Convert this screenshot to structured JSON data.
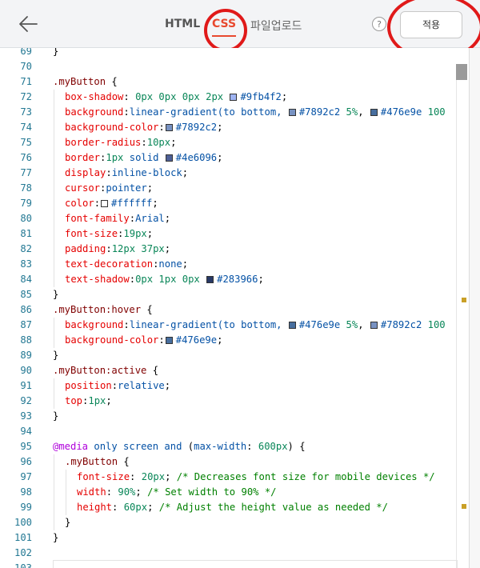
{
  "header": {
    "tabs": [
      {
        "label": "HTML",
        "active": false
      },
      {
        "label": "CSS",
        "active": true
      },
      {
        "label": "파일업로드",
        "active": false
      }
    ],
    "help_label": "?",
    "apply_label": "적용"
  },
  "colors": {
    "accent": "#e8492f",
    "annotation_circle": "#e01919"
  },
  "editor": {
    "lines": [
      {
        "n": "69",
        "indent": 0,
        "tokens": [
          {
            "c": "t-punc",
            "t": "}"
          }
        ]
      },
      {
        "n": "70",
        "indent": 0,
        "tokens": []
      },
      {
        "n": "71",
        "indent": 0,
        "tokens": [
          {
            "c": "t-sel",
            "t": ".myButton"
          },
          {
            "c": "t-punc",
            "t": " {"
          }
        ]
      },
      {
        "n": "72",
        "indent": 1,
        "tokens": [
          {
            "c": "t-prop",
            "t": "box-shadow"
          },
          {
            "c": "t-punc",
            "t": ": "
          },
          {
            "c": "t-num",
            "t": "0px 0px 0px 2px "
          },
          {
            "sw": "#9fb4f2"
          },
          {
            "c": "t-val",
            "t": "#9fb4f2"
          },
          {
            "c": "t-punc",
            "t": ";"
          }
        ]
      },
      {
        "n": "73",
        "indent": 1,
        "tokens": [
          {
            "c": "t-prop",
            "t": "background"
          },
          {
            "c": "t-punc",
            "t": ":"
          },
          {
            "c": "t-val",
            "t": "linear-gradient(to bottom, "
          },
          {
            "sw": "#7892c2"
          },
          {
            "c": "t-val",
            "t": "#7892c2 "
          },
          {
            "c": "t-num",
            "t": "5%"
          },
          {
            "c": "t-punc",
            "t": ", "
          },
          {
            "sw": "#476e9e"
          },
          {
            "c": "t-val",
            "t": "#476e9e "
          },
          {
            "c": "t-num",
            "t": "100"
          }
        ]
      },
      {
        "n": "74",
        "indent": 1,
        "tokens": [
          {
            "c": "t-prop",
            "t": "background-color"
          },
          {
            "c": "t-punc",
            "t": ":"
          },
          {
            "sw": "#7892c2"
          },
          {
            "c": "t-val",
            "t": "#7892c2"
          },
          {
            "c": "t-punc",
            "t": ";"
          }
        ]
      },
      {
        "n": "75",
        "indent": 1,
        "tokens": [
          {
            "c": "t-prop",
            "t": "border-radius"
          },
          {
            "c": "t-punc",
            "t": ":"
          },
          {
            "c": "t-num",
            "t": "10px"
          },
          {
            "c": "t-punc",
            "t": ";"
          }
        ]
      },
      {
        "n": "76",
        "indent": 1,
        "tokens": [
          {
            "c": "t-prop",
            "t": "border"
          },
          {
            "c": "t-punc",
            "t": ":"
          },
          {
            "c": "t-num",
            "t": "1px "
          },
          {
            "c": "t-val",
            "t": "solid "
          },
          {
            "sw": "#4e6096"
          },
          {
            "c": "t-val",
            "t": "#4e6096"
          },
          {
            "c": "t-punc",
            "t": ";"
          }
        ]
      },
      {
        "n": "77",
        "indent": 1,
        "tokens": [
          {
            "c": "t-prop",
            "t": "display"
          },
          {
            "c": "t-punc",
            "t": ":"
          },
          {
            "c": "t-val",
            "t": "inline-block"
          },
          {
            "c": "t-punc",
            "t": ";"
          }
        ]
      },
      {
        "n": "78",
        "indent": 1,
        "tokens": [
          {
            "c": "t-prop",
            "t": "cursor"
          },
          {
            "c": "t-punc",
            "t": ":"
          },
          {
            "c": "t-val",
            "t": "pointer"
          },
          {
            "c": "t-punc",
            "t": ";"
          }
        ]
      },
      {
        "n": "79",
        "indent": 1,
        "tokens": [
          {
            "c": "t-prop",
            "t": "color"
          },
          {
            "c": "t-punc",
            "t": ":"
          },
          {
            "sw": "#ffffff"
          },
          {
            "c": "t-val",
            "t": "#ffffff"
          },
          {
            "c": "t-punc",
            "t": ";"
          }
        ]
      },
      {
        "n": "80",
        "indent": 1,
        "tokens": [
          {
            "c": "t-prop",
            "t": "font-family"
          },
          {
            "c": "t-punc",
            "t": ":"
          },
          {
            "c": "t-val",
            "t": "Arial"
          },
          {
            "c": "t-punc",
            "t": ";"
          }
        ]
      },
      {
        "n": "81",
        "indent": 1,
        "tokens": [
          {
            "c": "t-prop",
            "t": "font-size"
          },
          {
            "c": "t-punc",
            "t": ":"
          },
          {
            "c": "t-num",
            "t": "19px"
          },
          {
            "c": "t-punc",
            "t": ";"
          }
        ]
      },
      {
        "n": "82",
        "indent": 1,
        "tokens": [
          {
            "c": "t-prop",
            "t": "padding"
          },
          {
            "c": "t-punc",
            "t": ":"
          },
          {
            "c": "t-num",
            "t": "12px 37px"
          },
          {
            "c": "t-punc",
            "t": ";"
          }
        ]
      },
      {
        "n": "83",
        "indent": 1,
        "tokens": [
          {
            "c": "t-prop",
            "t": "text-decoration"
          },
          {
            "c": "t-punc",
            "t": ":"
          },
          {
            "c": "t-val",
            "t": "none"
          },
          {
            "c": "t-punc",
            "t": ";"
          }
        ]
      },
      {
        "n": "84",
        "indent": 1,
        "tokens": [
          {
            "c": "t-prop",
            "t": "text-shadow"
          },
          {
            "c": "t-punc",
            "t": ":"
          },
          {
            "c": "t-num",
            "t": "0px 1px 0px "
          },
          {
            "sw": "#283966"
          },
          {
            "c": "t-val",
            "t": "#283966"
          },
          {
            "c": "t-punc",
            "t": ";"
          }
        ]
      },
      {
        "n": "85",
        "indent": 0,
        "tokens": [
          {
            "c": "t-punc",
            "t": "}"
          }
        ]
      },
      {
        "n": "86",
        "indent": 0,
        "tokens": [
          {
            "c": "t-sel",
            "t": ".myButton:hover"
          },
          {
            "c": "t-punc",
            "t": " {"
          }
        ]
      },
      {
        "n": "87",
        "indent": 1,
        "tokens": [
          {
            "c": "t-prop",
            "t": "background"
          },
          {
            "c": "t-punc",
            "t": ":"
          },
          {
            "c": "t-val",
            "t": "linear-gradient(to bottom, "
          },
          {
            "sw": "#476e9e"
          },
          {
            "c": "t-val",
            "t": "#476e9e "
          },
          {
            "c": "t-num",
            "t": "5%"
          },
          {
            "c": "t-punc",
            "t": ", "
          },
          {
            "sw": "#7892c2"
          },
          {
            "c": "t-val",
            "t": "#7892c2 "
          },
          {
            "c": "t-num",
            "t": "100"
          }
        ]
      },
      {
        "n": "88",
        "indent": 1,
        "tokens": [
          {
            "c": "t-prop",
            "t": "background-color"
          },
          {
            "c": "t-punc",
            "t": ":"
          },
          {
            "sw": "#476e9e"
          },
          {
            "c": "t-val",
            "t": "#476e9e"
          },
          {
            "c": "t-punc",
            "t": ";"
          }
        ]
      },
      {
        "n": "89",
        "indent": 0,
        "tokens": [
          {
            "c": "t-punc",
            "t": "}"
          }
        ]
      },
      {
        "n": "90",
        "indent": 0,
        "tokens": [
          {
            "c": "t-sel",
            "t": ".myButton:active"
          },
          {
            "c": "t-punc",
            "t": " {"
          }
        ]
      },
      {
        "n": "91",
        "indent": 1,
        "tokens": [
          {
            "c": "t-prop",
            "t": "position"
          },
          {
            "c": "t-punc",
            "t": ":"
          },
          {
            "c": "t-val",
            "t": "relative"
          },
          {
            "c": "t-punc",
            "t": ";"
          }
        ]
      },
      {
        "n": "92",
        "indent": 1,
        "tokens": [
          {
            "c": "t-prop",
            "t": "top"
          },
          {
            "c": "t-punc",
            "t": ":"
          },
          {
            "c": "t-num",
            "t": "1px"
          },
          {
            "c": "t-punc",
            "t": ";"
          }
        ]
      },
      {
        "n": "93",
        "indent": 0,
        "tokens": [
          {
            "c": "t-punc",
            "t": "}"
          }
        ]
      },
      {
        "n": "94",
        "indent": 0,
        "tokens": []
      },
      {
        "n": "95",
        "indent": 0,
        "tokens": [
          {
            "c": "t-kw",
            "t": "@media"
          },
          {
            "c": "t-val",
            "t": " only screen and "
          },
          {
            "c": "t-punc",
            "t": "("
          },
          {
            "c": "t-val",
            "t": "max-width"
          },
          {
            "c": "t-punc",
            "t": ": "
          },
          {
            "c": "t-num",
            "t": "600px"
          },
          {
            "c": "t-punc",
            "t": ") {"
          }
        ]
      },
      {
        "n": "96",
        "indent": 1,
        "tokens": [
          {
            "c": "t-sel",
            "t": ".myButton"
          },
          {
            "c": "t-punc",
            "t": " {"
          }
        ]
      },
      {
        "n": "97",
        "indent": 2,
        "tokens": [
          {
            "c": "t-prop",
            "t": "font-size"
          },
          {
            "c": "t-punc",
            "t": ": "
          },
          {
            "c": "t-num",
            "t": "20px"
          },
          {
            "c": "t-punc",
            "t": "; "
          },
          {
            "c": "t-com",
            "t": "/* Decreases font size for mobile devices */"
          }
        ]
      },
      {
        "n": "98",
        "indent": 2,
        "tokens": [
          {
            "c": "t-prop",
            "t": "width"
          },
          {
            "c": "t-punc",
            "t": ": "
          },
          {
            "c": "t-num",
            "t": "90%"
          },
          {
            "c": "t-punc",
            "t": "; "
          },
          {
            "c": "t-com",
            "t": "/* Set width to 90% */"
          }
        ]
      },
      {
        "n": "99",
        "indent": 2,
        "tokens": [
          {
            "c": "t-prop",
            "t": "height"
          },
          {
            "c": "t-punc",
            "t": ": "
          },
          {
            "c": "t-num",
            "t": "60px"
          },
          {
            "c": "t-punc",
            "t": "; "
          },
          {
            "c": "t-com",
            "t": "/* Adjust the height value as needed */"
          }
        ]
      },
      {
        "n": "100",
        "indent": 1,
        "tokens": [
          {
            "c": "t-punc",
            "t": "}"
          }
        ]
      },
      {
        "n": "101",
        "indent": 0,
        "tokens": [
          {
            "c": "t-punc",
            "t": "}"
          }
        ]
      },
      {
        "n": "102",
        "indent": 0,
        "tokens": []
      },
      {
        "n": "103",
        "indent": 0,
        "tokens": []
      }
    ]
  }
}
